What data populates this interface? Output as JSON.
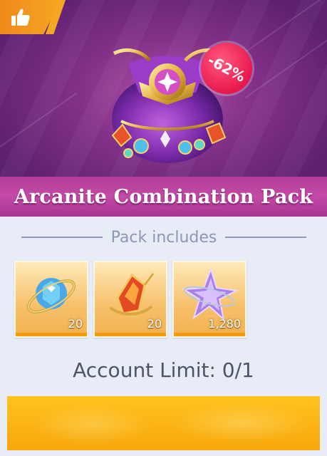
{
  "pack": {
    "title": "Arcanite Combination Pack",
    "discount": "-62%",
    "includes_label": "Pack includes",
    "items": [
      {
        "name": "Arcanite orb",
        "count": "20",
        "icon": "blue-orb-icon"
      },
      {
        "name": "Arcanite crystal",
        "count": "20",
        "icon": "red-crystal-icon"
      },
      {
        "name": "Star shard",
        "count": "1,280",
        "icon": "purple-star-icon"
      }
    ],
    "account_limit": "Account Limit: 0/1"
  },
  "colors": {
    "accent": "#f5a623",
    "title_band": "#c34aa6",
    "discount": "#e8184e",
    "background": "#e8ecf6"
  }
}
